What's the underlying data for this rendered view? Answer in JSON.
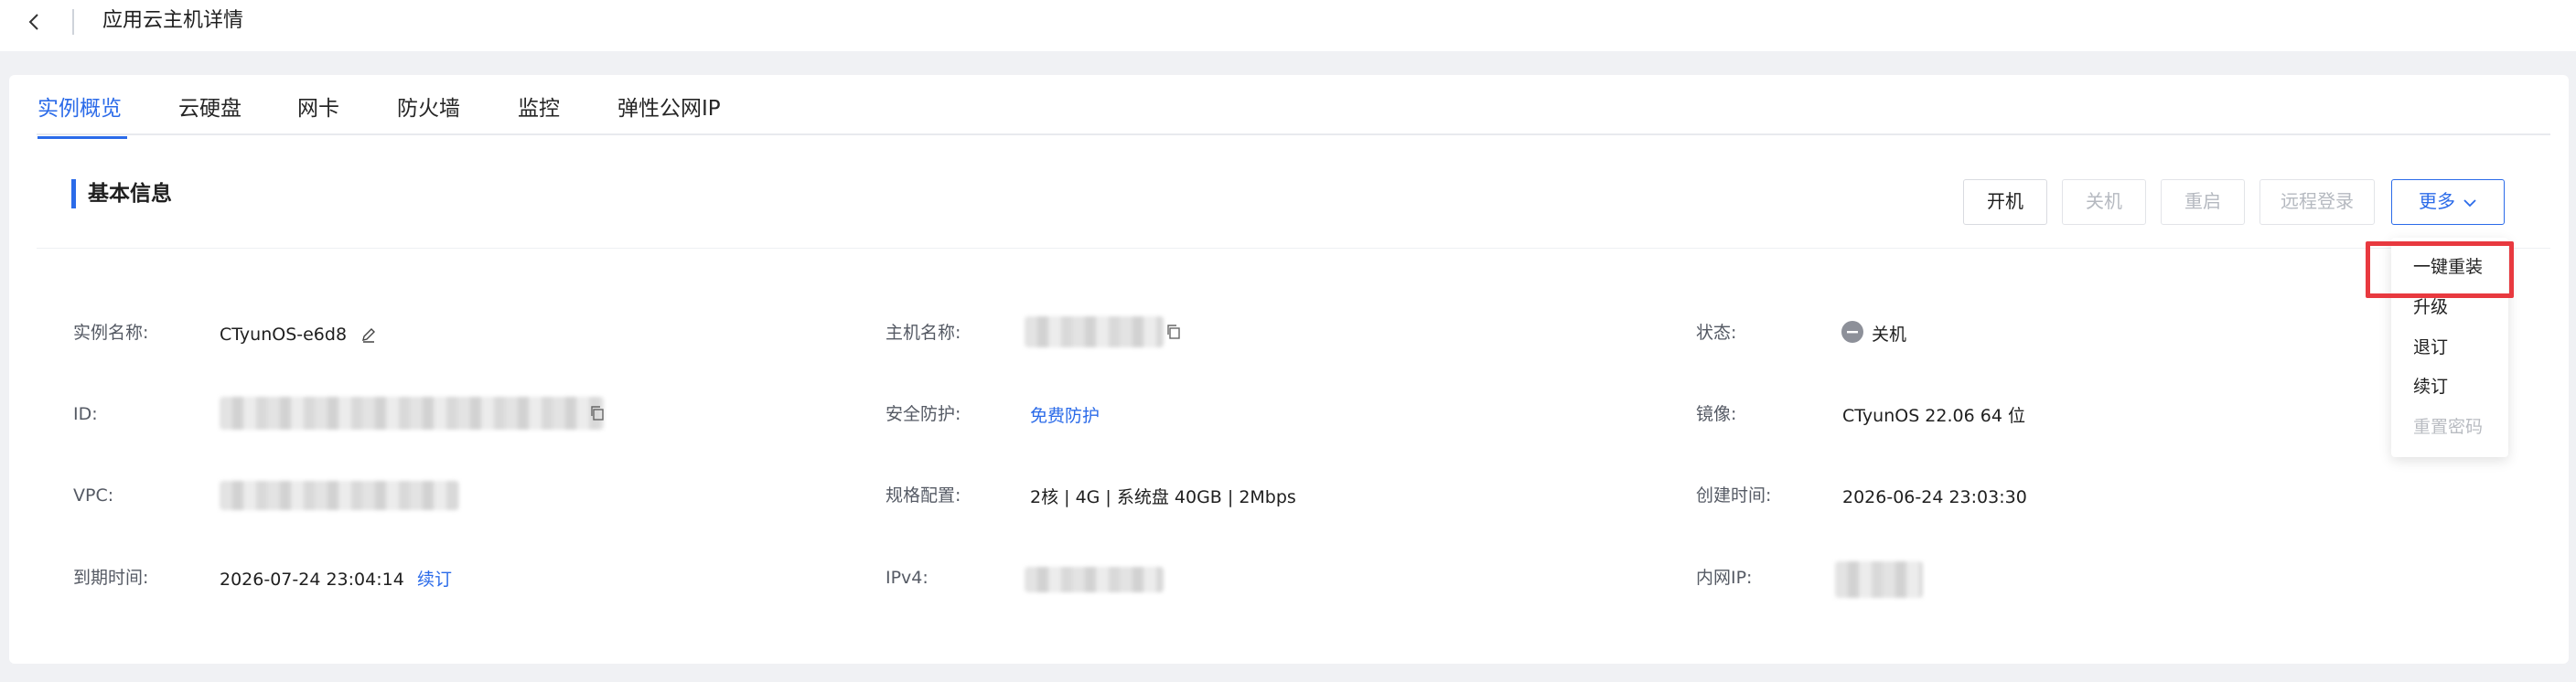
{
  "header": {
    "title": "应用云主机详情"
  },
  "tabs": [
    {
      "label": "实例概览"
    },
    {
      "label": "云硬盘"
    },
    {
      "label": "网卡"
    },
    {
      "label": "防火墙"
    },
    {
      "label": "监控"
    },
    {
      "label": "弹性公网IP"
    }
  ],
  "active_tab": "实例概览",
  "section": {
    "title": "基本信息"
  },
  "actions": {
    "start": "开机",
    "stop": "关机",
    "restart": "重启",
    "remote_login": "远程登录",
    "more": "更多"
  },
  "dropdown": {
    "items": [
      "一键重装",
      "升级",
      "退订",
      "续订",
      "重置密码"
    ],
    "highlighted": "一键重装"
  },
  "info": {
    "instance_name": {
      "label": "实例名称:",
      "value": "CTyunOS-e6d8"
    },
    "id": {
      "label": "ID:"
    },
    "vpc": {
      "label": "VPC:"
    },
    "expire_time": {
      "label": "到期时间:",
      "value": "2026-07-24 23:04:14",
      "action": "续订"
    },
    "host_name": {
      "label": "主机名称:"
    },
    "security": {
      "label": "安全防护:",
      "value": "免费防护"
    },
    "spec": {
      "label": "规格配置:",
      "value": "2核 | 4G | 系统盘 40GB | 2Mbps"
    },
    "ipv4": {
      "label": "IPv4:"
    },
    "status": {
      "label": "状态:",
      "value": "关机"
    },
    "image": {
      "label": "镜像:",
      "value": "CTyunOS 22.06 64 位"
    },
    "created_time": {
      "label": "创建时间:",
      "value": "2026-06-24 23:03:30"
    },
    "private_ip": {
      "label": "内网IP:"
    }
  },
  "colors": {
    "accent": "#2b6be9",
    "highlight_border": "#e8393f",
    "page_background": "#f0f1f4"
  }
}
